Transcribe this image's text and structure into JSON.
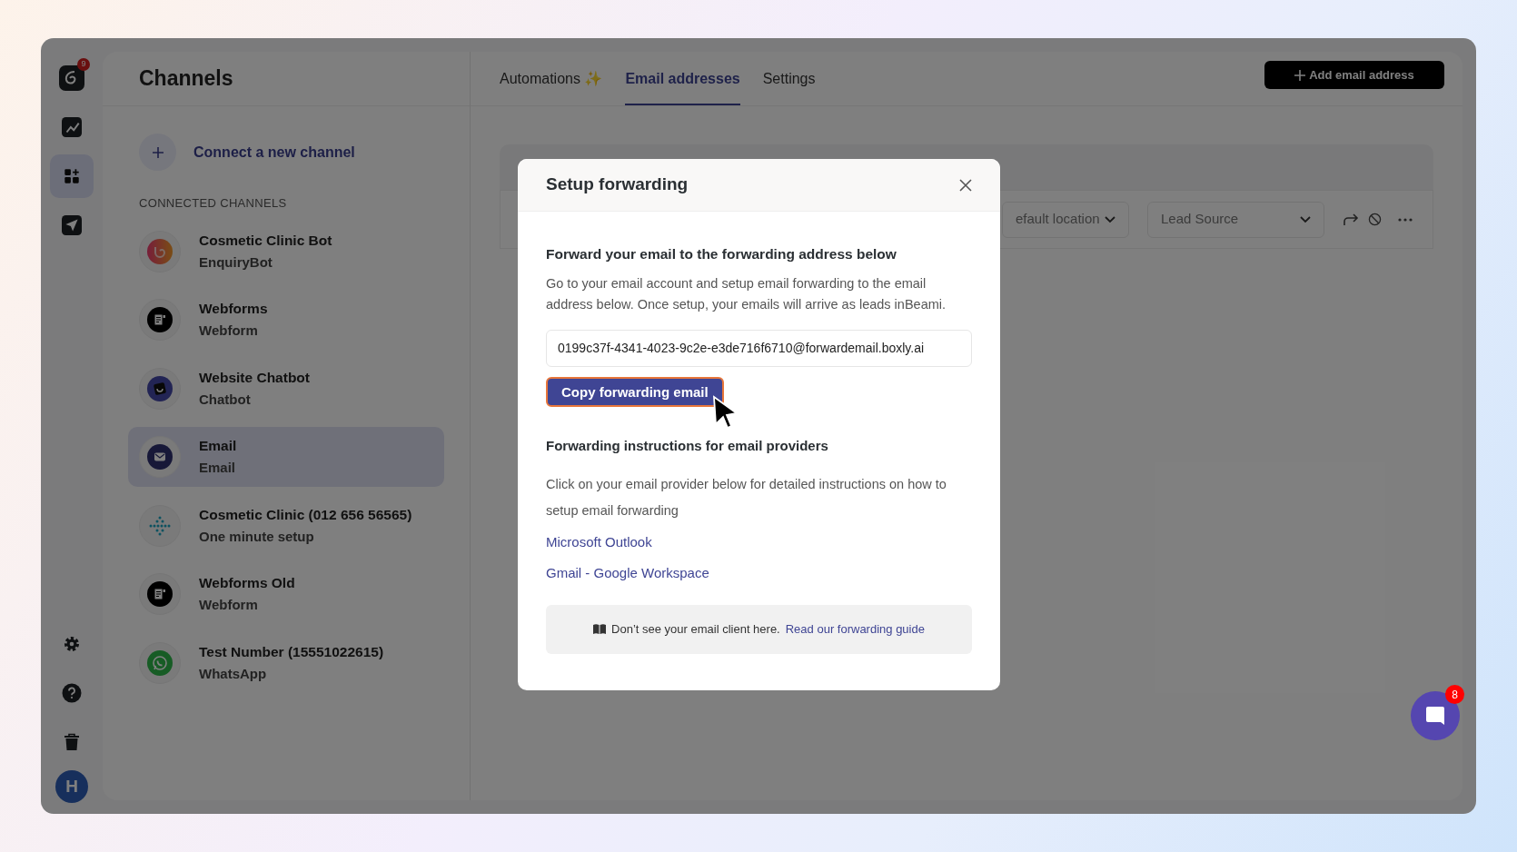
{
  "rail": {
    "items": [
      {
        "kind": "logo",
        "badge": "9",
        "selected": false
      },
      {
        "kind": "chart",
        "selected": false
      },
      {
        "kind": "apps",
        "selected": true
      },
      {
        "kind": "send",
        "selected": false
      }
    ],
    "bottom": [
      {
        "kind": "settings"
      },
      {
        "kind": "help"
      },
      {
        "kind": "trash"
      }
    ],
    "avatar": "H"
  },
  "title": "Channels",
  "connect": "Connect a new channel",
  "section": "CONNECTED CHANNELS",
  "channels": [
    {
      "name": "Cosmetic Clinic Bot",
      "type": "EnquiryBot",
      "kind": "bot",
      "selected": false
    },
    {
      "name": "Webforms",
      "type": "Webform",
      "kind": "form",
      "selected": false
    },
    {
      "name": "Website Chatbot",
      "type": "Chatbot",
      "kind": "chatbot",
      "selected": false
    },
    {
      "name": "Email",
      "type": "Email",
      "kind": "email",
      "selected": true
    },
    {
      "name": "Cosmetic Clinic (012 656 56565)",
      "type": "One minute setup",
      "kind": "dots",
      "selected": false
    },
    {
      "name": "Webforms Old",
      "type": "Webform",
      "kind": "form",
      "selected": false
    },
    {
      "name": "Test Number (15551022615)",
      "type": "WhatsApp",
      "kind": "whatsapp",
      "selected": false
    }
  ],
  "tabs": [
    {
      "label": "Automations ✨",
      "selected": false
    },
    {
      "label": "Email addresses",
      "selected": true
    },
    {
      "label": "Settings",
      "selected": false
    }
  ],
  "add_button": "Add email address",
  "filters": [
    {
      "label": "efault location"
    },
    {
      "label": "Lead Source"
    }
  ],
  "modal": {
    "title": "Setup forwarding",
    "heading": "Forward your email to the forwarding address below",
    "description": "Go to your email account and setup email forwarding to the email address below. Once setup, your emails will arrive as leads inBeami.",
    "address": "0199c37f-4341-4023-9c2e-e3de716f6710@forwardemail.boxly.ai",
    "copy_button": "Copy forwarding email",
    "providers_heading": "Forwarding instructions for email providers",
    "providers_text": "Click on your email provider below for detailed instructions on how to setup email forwarding",
    "providers": [
      "Microsoft Outlook",
      "Gmail - Google Workspace"
    ],
    "note": "Don’t see your email client here.",
    "note_link": "Read our forwarding guide"
  },
  "chat_badge": "8"
}
